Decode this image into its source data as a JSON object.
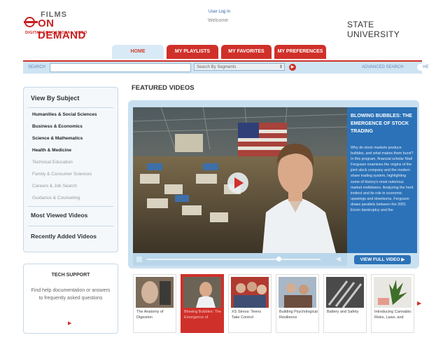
{
  "header": {
    "logo_top": "FILMS",
    "logo_main": "ON DEMAND",
    "logo_sub": "DIGITAL EDUCATIONAL VIDEO",
    "login": "User Log In",
    "welcome": "Welcome",
    "institution": "STATE UNIVERSITY"
  },
  "tabs": [
    {
      "label": "HOME",
      "active": true
    },
    {
      "label": "MY PLAYLISTS",
      "active": false
    },
    {
      "label": "MY FAVORITES",
      "active": false
    },
    {
      "label": "MY PREFERENCES",
      "active": false
    }
  ],
  "search": {
    "label": "SEARCH",
    "value": "",
    "select_value": "Search By Segments",
    "advanced": "ADVANCED SEARCH",
    "help": "HELP"
  },
  "sidebar": {
    "title": "View By Subject",
    "subjects": [
      {
        "label": "Humanities & Social Sciences",
        "style": "dark"
      },
      {
        "label": "Business & Economics",
        "style": "dark"
      },
      {
        "label": "Science & Mathematics",
        "style": "dark"
      },
      {
        "label": "Health & Medicine",
        "style": "dark"
      },
      {
        "label": "Technical Education",
        "style": "gray"
      },
      {
        "label": "Family & Consumer Sciences",
        "style": "gray"
      },
      {
        "label": "Careers & Job Search",
        "style": "gray"
      },
      {
        "label": "Guidance & Counseling",
        "style": "gray"
      }
    ],
    "most_viewed": "Most Viewed Videos",
    "recently_added": "Recently Added Videos"
  },
  "tech_support": {
    "title": "TECH SUPPORT",
    "text": "Find help documentation or answers to frequently asked questions"
  },
  "featured": {
    "title": "FEATURED VIDEOS",
    "video_title": "BLOWING BUBBLES: THE EMERGENCE OF STOCK TRADING",
    "description": "Why do stock markets produce bubbles, and what makes them burst? In this program, financial scholar Niall Ferguson examines the origins of the joint stock company and the modern share trading system, highlighting some of history's most notorious market meltdowns. Analyzing the herd instinct and its role in economic upswings and downturns, Ferguson draws parallels between the 2001 Enron bankruptcy and the",
    "view_full": "VIEW FULL VIDEO",
    "progress": 0.78
  },
  "thumbnails": [
    {
      "caption": "The Anatomy of Digestion",
      "active": false
    },
    {
      "caption": "Blowing Bubbles: The Emergence of",
      "active": true
    },
    {
      "caption": "XS Stress: Teens Take Control",
      "active": false
    },
    {
      "caption": "Building Psychological Resilience",
      "active": false
    },
    {
      "caption": "Battery and Safety",
      "active": false
    },
    {
      "caption": "Introducing Cannabis: Risks, Laws, and",
      "active": false
    }
  ],
  "colors": {
    "brand_red": "#d0302a",
    "nav_blue": "#cfe4f3",
    "accent_blue": "#2c72b8"
  }
}
